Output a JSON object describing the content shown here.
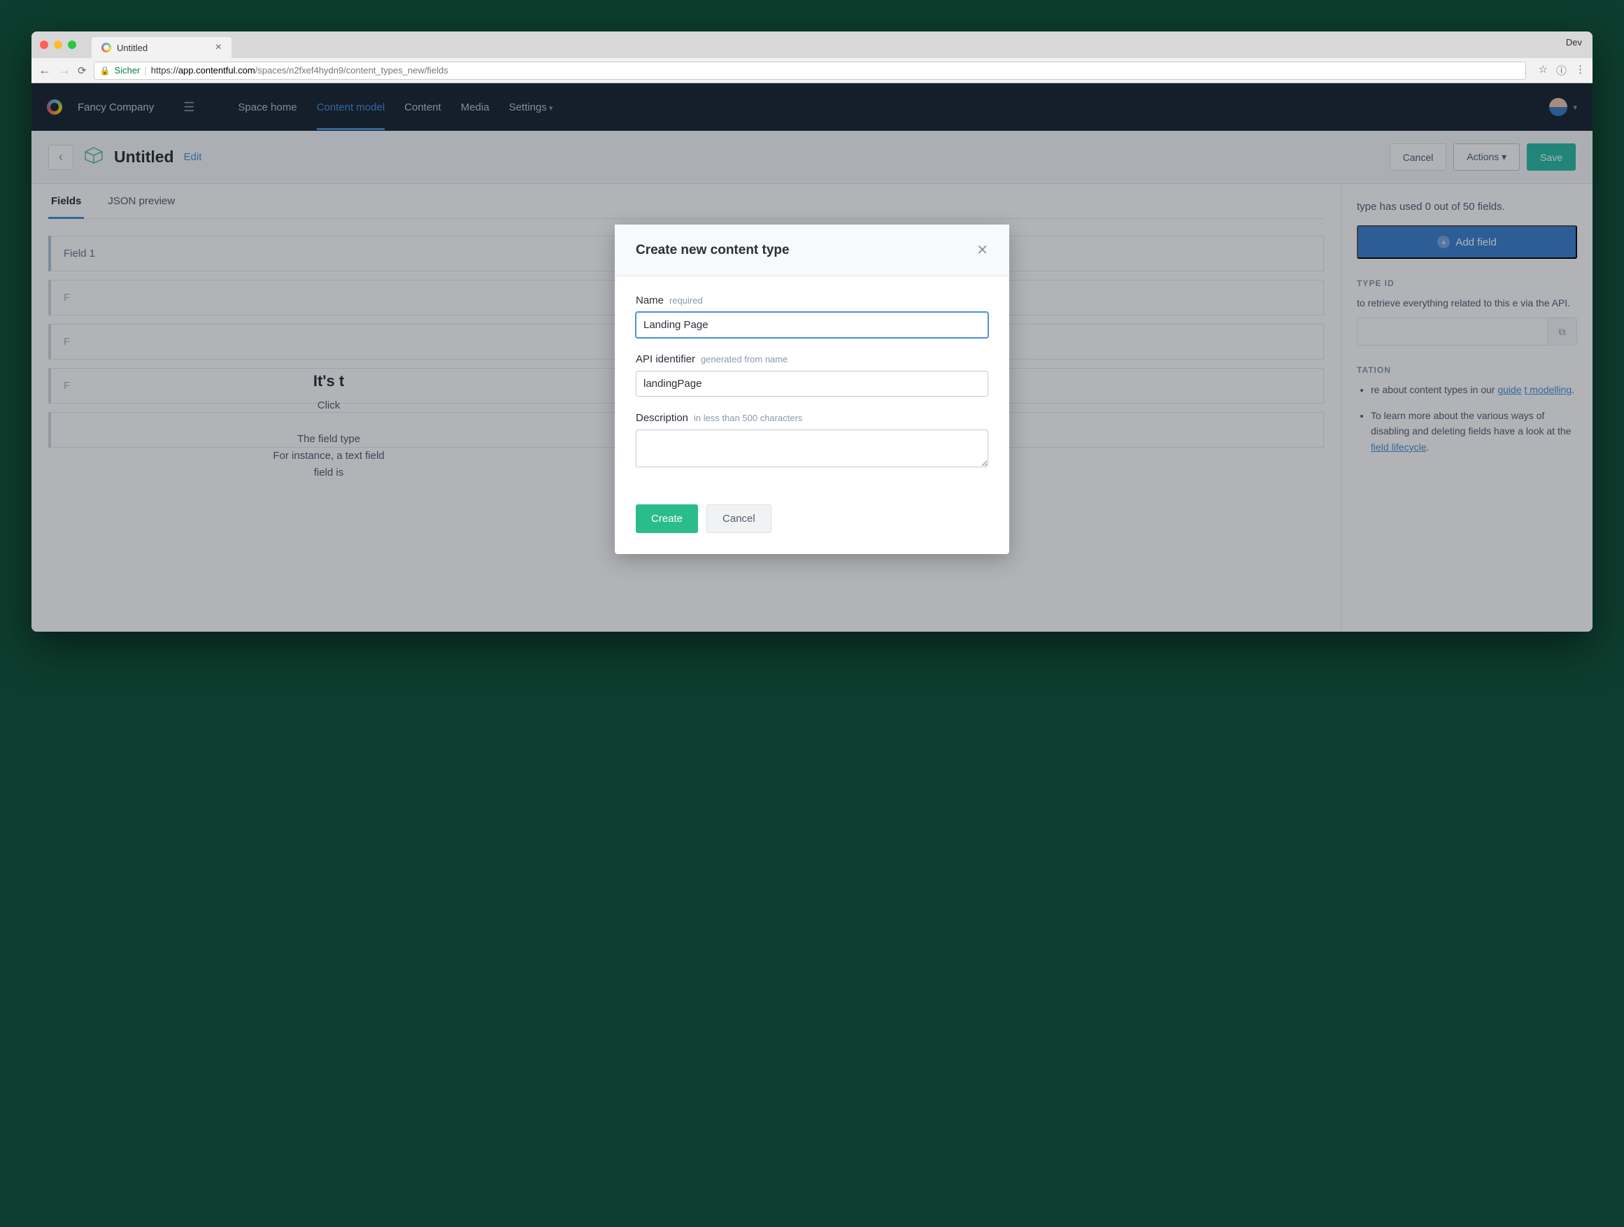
{
  "browser": {
    "tab_title": "Untitled",
    "dev_label": "Dev",
    "secure_label": "Sicher",
    "url_host": "app.contentful.com",
    "url_scheme": "https://",
    "url_path": "/spaces/n2fxef4hydn9/content_types_new/fields"
  },
  "topbar": {
    "company": "Fancy Company",
    "nav": {
      "space_home": "Space home",
      "content_model": "Content model",
      "content": "Content",
      "media": "Media",
      "settings": "Settings"
    }
  },
  "page_header": {
    "title": "Untitled",
    "edit": "Edit",
    "cancel": "Cancel",
    "actions": "Actions",
    "save": "Save"
  },
  "tabs": {
    "fields": "Fields",
    "json_preview": "JSON preview"
  },
  "fields_list": {
    "f1": "Field 1"
  },
  "empty_hint": {
    "title": "It's t",
    "line1": "Click",
    "line2": "The field type",
    "line3": "For instance, a text field",
    "line4": "field is"
  },
  "sidebar": {
    "status": "type has used 0 out of 50 fields.",
    "add_field": "Add field",
    "type_id_heading": "TYPE ID",
    "type_id_text": "to retrieve everything related to this e via the API.",
    "doc_heading": "TATION",
    "doc1_prefix": "re about content types in our ",
    "doc1_link1": "guide",
    "doc1_link2": "t modelling",
    "doc2_prefix": "To learn more about the various ways of disabling and deleting fields have a look at the ",
    "doc2_link": "field lifecycle"
  },
  "modal": {
    "title": "Create new content type",
    "name_label": "Name",
    "name_hint": "required",
    "name_value": "Landing Page",
    "api_label": "API identifier",
    "api_hint": "generated from name",
    "api_value": "landingPage",
    "desc_label": "Description",
    "desc_hint": "in less than 500 characters",
    "desc_value": "",
    "create": "Create",
    "cancel": "Cancel"
  }
}
